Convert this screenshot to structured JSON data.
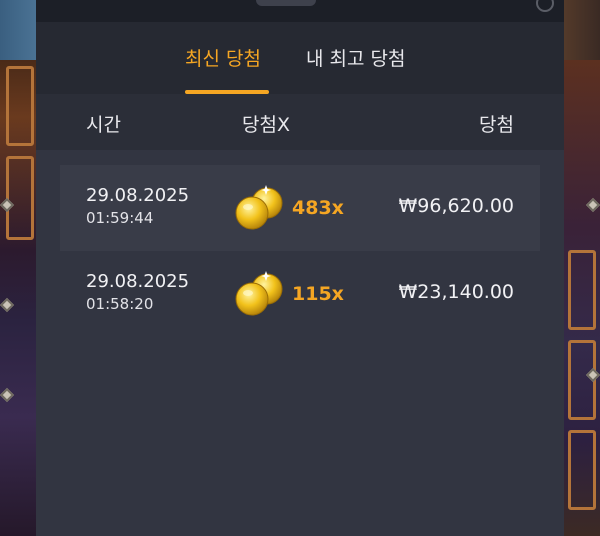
{
  "tabs": [
    {
      "label": "최신 당첨",
      "active": true
    },
    {
      "label": "내 최고 당첨",
      "active": false
    }
  ],
  "columns": {
    "time": "시간",
    "multiplier": "당첨X",
    "win": "당첨"
  },
  "rows": [
    {
      "date": "29.08.2025",
      "time": "01:59:44",
      "multiplier": "483x",
      "amount": "₩96,620.00",
      "icon": "gold-coins-icon",
      "highlighted": true
    },
    {
      "date": "29.08.2025",
      "time": "01:58:20",
      "multiplier": "115x",
      "amount": "₩23,140.00",
      "icon": "gold-coins-icon",
      "highlighted": false
    }
  ],
  "colors": {
    "accent": "#f5a623",
    "panel": "#323541",
    "tabBar": "#262932",
    "rowHighlight": "#393c48"
  }
}
